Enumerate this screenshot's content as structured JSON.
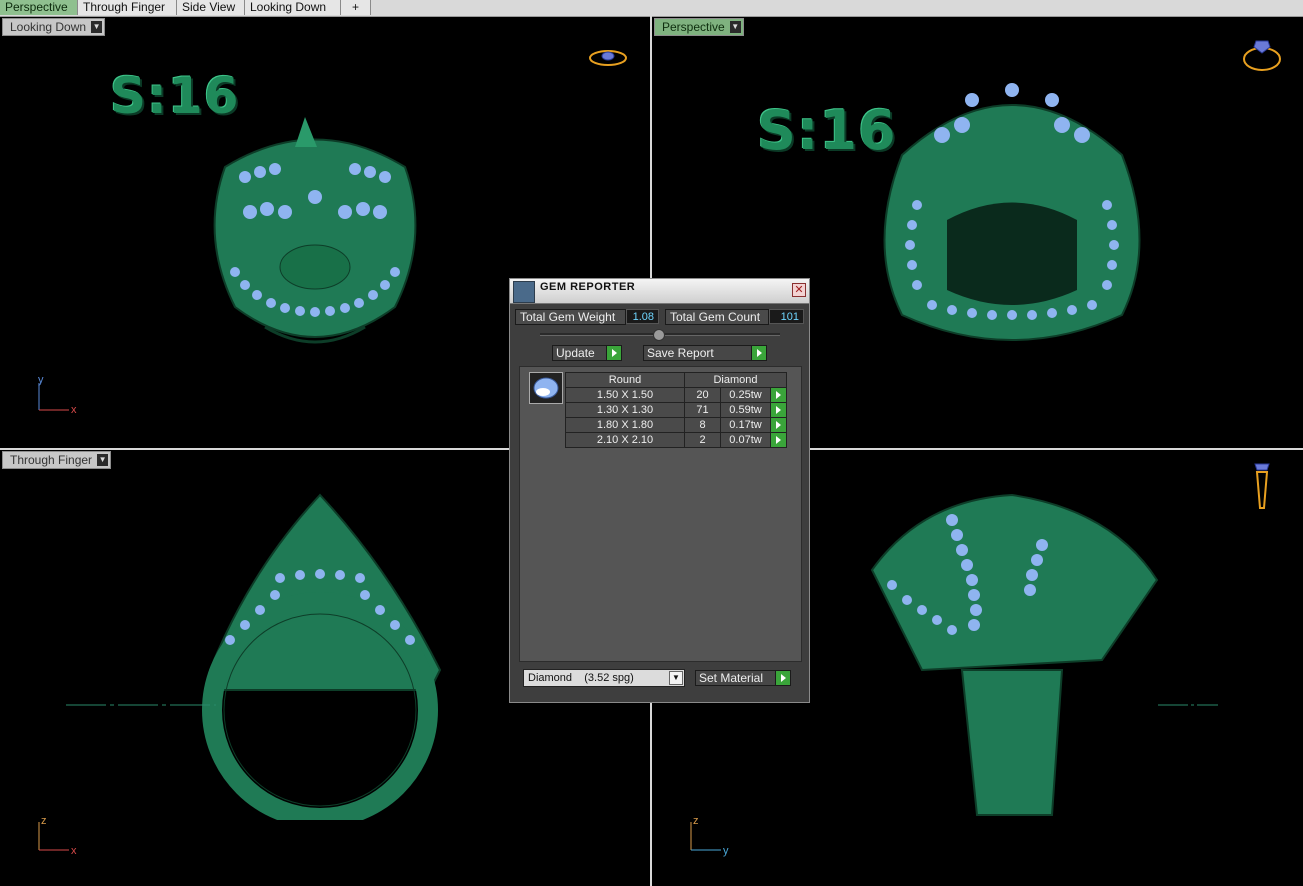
{
  "tabs": [
    {
      "label": "Perspective",
      "active": true
    },
    {
      "label": "Through Finger",
      "active": false
    },
    {
      "label": "Side View",
      "active": false
    },
    {
      "label": "Looking Down",
      "active": false
    },
    {
      "label": "+",
      "active": false
    }
  ],
  "viewports": {
    "top_left": {
      "label": "Looking Down",
      "size_text": "S:16",
      "axis_up": "y",
      "axis_right": "x"
    },
    "top_right": {
      "label": "Perspective",
      "size_text": "S:16"
    },
    "bottom_left": {
      "label": "Through Finger",
      "axis_up": "z",
      "axis_right": "x"
    },
    "bottom_right": {
      "axis_up": "z",
      "axis_right": "y"
    }
  },
  "gem_reporter": {
    "title": "GEM REPORTER",
    "close_label": "✕",
    "total_weight_label": "Total Gem Weight",
    "total_weight_value": "1.08",
    "total_count_label": "Total Gem Count",
    "total_count_value": "101",
    "update_label": "Update",
    "save_report_label": "Save Report",
    "table": {
      "col_shape": "Round",
      "col_material": "Diamond",
      "rows": [
        {
          "size": "1.50 X 1.50",
          "count": "20",
          "weight": "0.25tw"
        },
        {
          "size": "1.30 X 1.30",
          "count": "71",
          "weight": "0.59tw"
        },
        {
          "size": "1.80 X 1.80",
          "count": "8",
          "weight": "0.17tw"
        },
        {
          "size": "2.10 X 2.10",
          "count": "2",
          "weight": "0.07tw"
        }
      ]
    },
    "material_select": "Diamond    (3.52 spg)",
    "set_material_label": "Set Material"
  },
  "colors": {
    "metal": "#1f7a55",
    "gem": "#8fb4f0",
    "accent_green": "#3aa53a"
  }
}
